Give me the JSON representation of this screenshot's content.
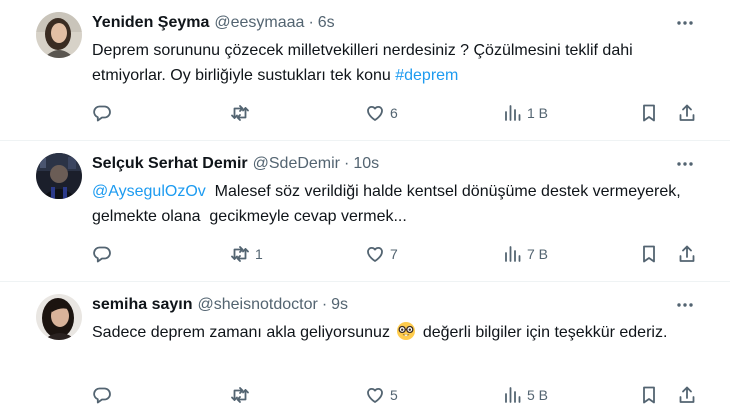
{
  "tweets": [
    {
      "name": "Yeniden Şeyma",
      "handle": "@eesymaaa",
      "separator": "·",
      "time": "6s",
      "text_before": "Deprem sorununu çözecek milletvekilleri nerdesiniz ? Çözülmesini teklif dahi etmiyorlar. Oy birliğiyle sustukları tek konu ",
      "hashtag": "#deprem",
      "reply_count": "",
      "retweet_count": "",
      "like_count": "6",
      "view_count": "1 B"
    },
    {
      "name": "Selçuk Serhat Demir",
      "handle": "@SdeDemir",
      "separator": "·",
      "time": "10s",
      "mention": "@AysegulOzOv",
      "text": "  Malesef söz verildiği halde kentsel dönüşüme destek vermeyerek, gelmekte olana  gecikmeyle cevap vermek...",
      "reply_count": "",
      "retweet_count": "1",
      "like_count": "7",
      "view_count": "7 B"
    },
    {
      "name": "semiha sayın",
      "handle": "@sheisnotdoctor",
      "separator": "·",
      "time": "9s",
      "text_before": "Sadece deprem zamanı akla geliyorsunuz ",
      "emoji": "nerd-face-emoji",
      "text_after": " değerli bilgiler için teşekkür ederiz.",
      "reply_count": "",
      "retweet_count": "",
      "like_count": "5",
      "view_count": "5 B"
    }
  ],
  "icons": {
    "reply": "reply-icon",
    "retweet": "retweet-icon",
    "like": "heart-icon",
    "views": "views-chart-icon",
    "bookmark": "bookmark-icon",
    "share": "share-icon",
    "more": "more-icon"
  },
  "colors": {
    "text": "#0f1419",
    "secondary": "#536471",
    "link": "#1d9bf0",
    "divider": "#eff3f4"
  }
}
